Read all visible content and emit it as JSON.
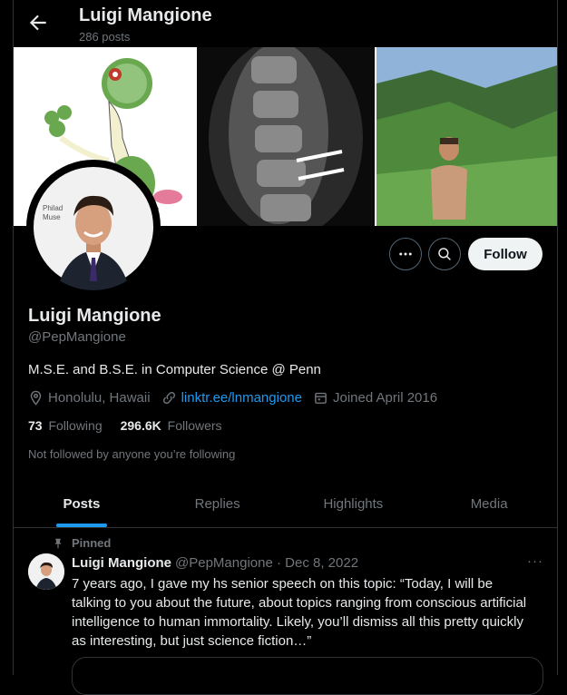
{
  "header": {
    "name": "Luigi Mangione",
    "post_count": "286 posts"
  },
  "profile": {
    "name": "Luigi Mangione",
    "handle": "@PepMangione",
    "bio": "M.S.E. and B.S.E. in Computer Science @ Penn",
    "location": "Honolulu, Hawaii",
    "link": "linktr.ee/lnmangione",
    "joined": "Joined April 2016",
    "following_count": "73",
    "following_label": "Following",
    "followers_count": "296.6K",
    "followers_label": "Followers",
    "followed_by": "Not followed by anyone you’re following",
    "follow_button": "Follow",
    "avatar_text": "Philad Muse"
  },
  "tabs": [
    "Posts",
    "Replies",
    "Highlights",
    "Media"
  ],
  "tweet": {
    "pinned_label": "Pinned",
    "name": "Luigi Mangione",
    "handle": "@PepMangione",
    "date": "Dec 8, 2022",
    "more": "···",
    "text": "7 years ago, I gave my hs senior speech on this topic: “Today, I will be talking to you about the future, about topics ranging from conscious artificial intelligence to human immortality. Likely, you’ll dismiss all this pretty quickly as interesting, but just science fiction…”"
  },
  "colors": {
    "accent": "#1d9bf0",
    "bg": "#000000",
    "muted": "#71767b"
  },
  "icons": [
    "back-arrow-icon",
    "more-icon",
    "search-icon",
    "location-icon",
    "link-icon",
    "calendar-icon",
    "pin-icon"
  ]
}
